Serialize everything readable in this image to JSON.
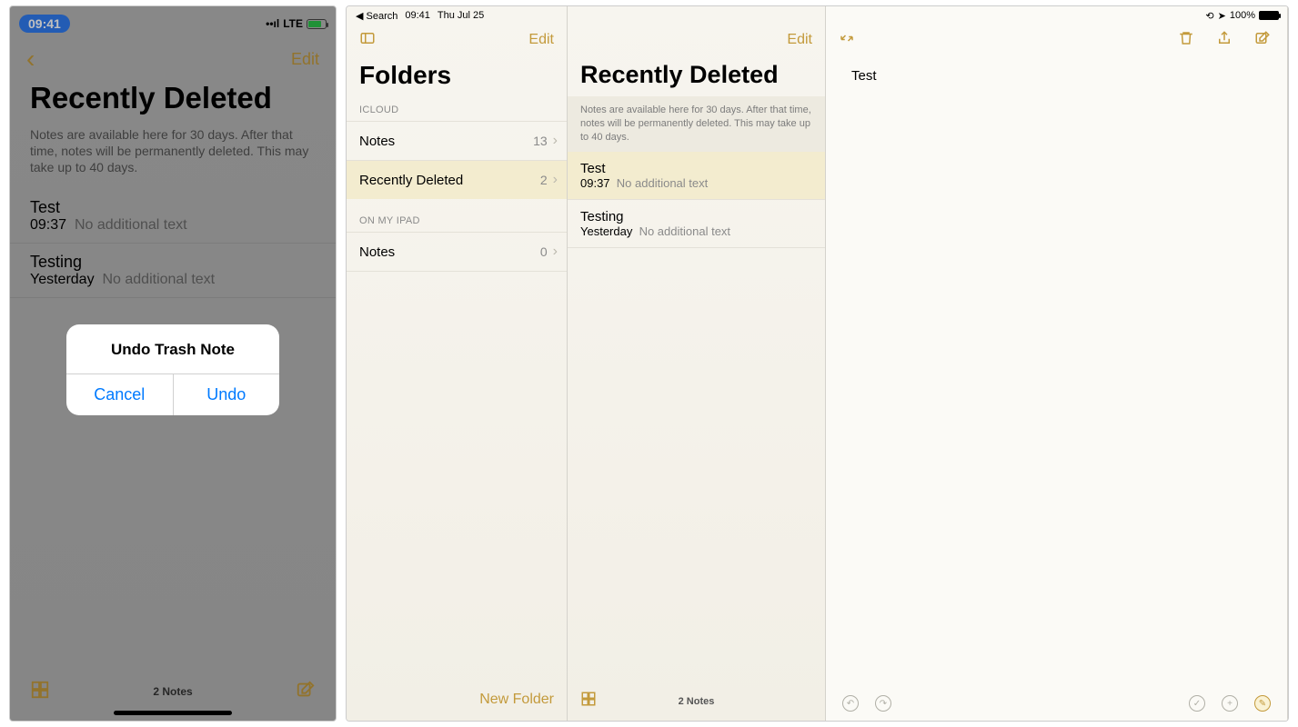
{
  "phone": {
    "statusbar": {
      "time": "09:41",
      "network": "LTE"
    },
    "nav": {
      "edit": "Edit"
    },
    "title": "Recently Deleted",
    "helper": "Notes are available here for 30 days. After that time, notes will be permanently deleted. This may take up to 40 days.",
    "notes": [
      {
        "title": "Test",
        "time": "09:37",
        "sub": "No additional text"
      },
      {
        "title": "Testing",
        "time": "Yesterday",
        "sub": "No additional text"
      }
    ],
    "bottom": {
      "count": "2 Notes"
    },
    "modal": {
      "title": "Undo Trash Note",
      "cancel": "Cancel",
      "undo": "Undo"
    }
  },
  "ipad": {
    "statusbar": {
      "back": "◀ Search",
      "time": "09:41",
      "date": "Thu Jul 25",
      "battery": "100%"
    },
    "folders": {
      "title": "Folders",
      "edit": "Edit",
      "sections": [
        {
          "label": "ICLOUD",
          "rows": [
            {
              "name": "Notes",
              "count": "13"
            },
            {
              "name": "Recently Deleted",
              "count": "2",
              "selected": true
            }
          ]
        },
        {
          "label": "ON MY IPAD",
          "rows": [
            {
              "name": "Notes",
              "count": "0"
            }
          ]
        }
      ],
      "new_folder": "New Folder"
    },
    "list": {
      "title": "Recently Deleted",
      "edit": "Edit",
      "helper": "Notes are available here for 30 days. After that time, notes will be permanently deleted. This may take up to 40 days.",
      "notes": [
        {
          "title": "Test",
          "time": "09:37",
          "sub": "No additional text",
          "selected": true
        },
        {
          "title": "Testing",
          "time": "Yesterday",
          "sub": "No additional text"
        }
      ],
      "count": "2 Notes"
    },
    "detail": {
      "content": "Test"
    }
  }
}
